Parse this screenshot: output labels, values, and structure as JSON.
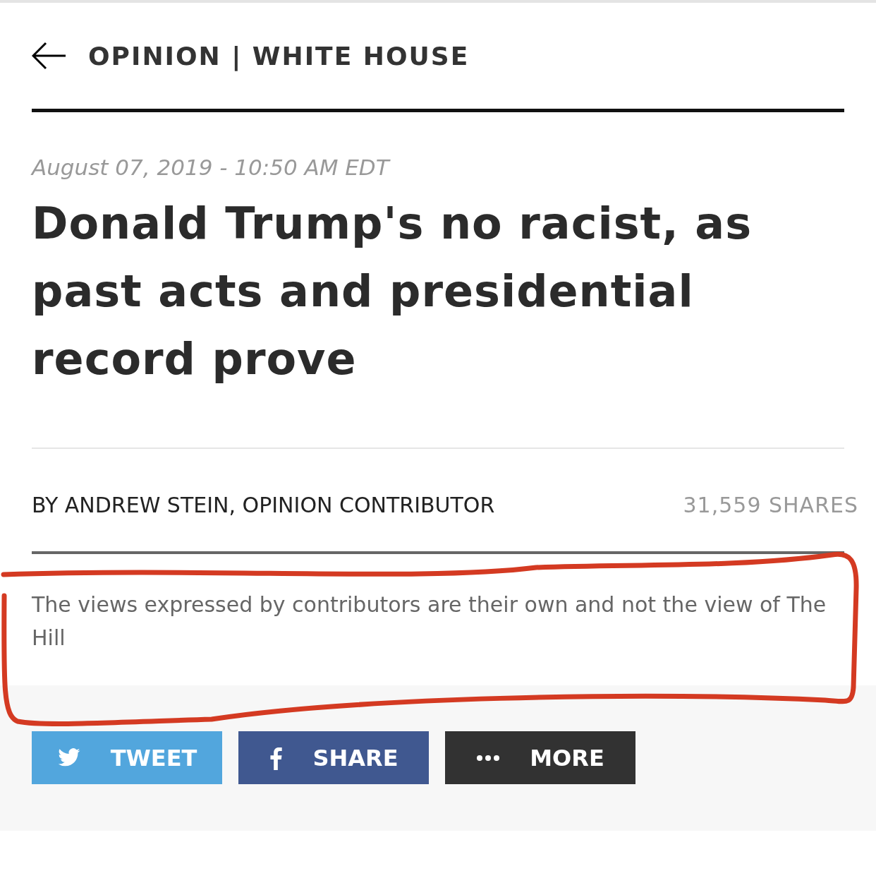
{
  "section": {
    "label": "OPINION | WHITE HOUSE"
  },
  "article": {
    "dateline": "August 07, 2019 - 10:50 AM EDT",
    "headline": "Donald Trump's no racist, as past acts and presidential record prove",
    "byline": "BY ANDREW STEIN, OPINION CONTRIBUTOR",
    "shares": "31,559 SHARES",
    "disclaimer": "The views expressed by contributors are their own and not the view of The Hill"
  },
  "share_buttons": [
    {
      "kind": "twitter",
      "label": "TWEET",
      "color": "#52a6dd"
    },
    {
      "kind": "facebook",
      "label": "SHARE",
      "color": "#405890"
    },
    {
      "kind": "more",
      "label": "MORE",
      "color": "#323232"
    }
  ]
}
